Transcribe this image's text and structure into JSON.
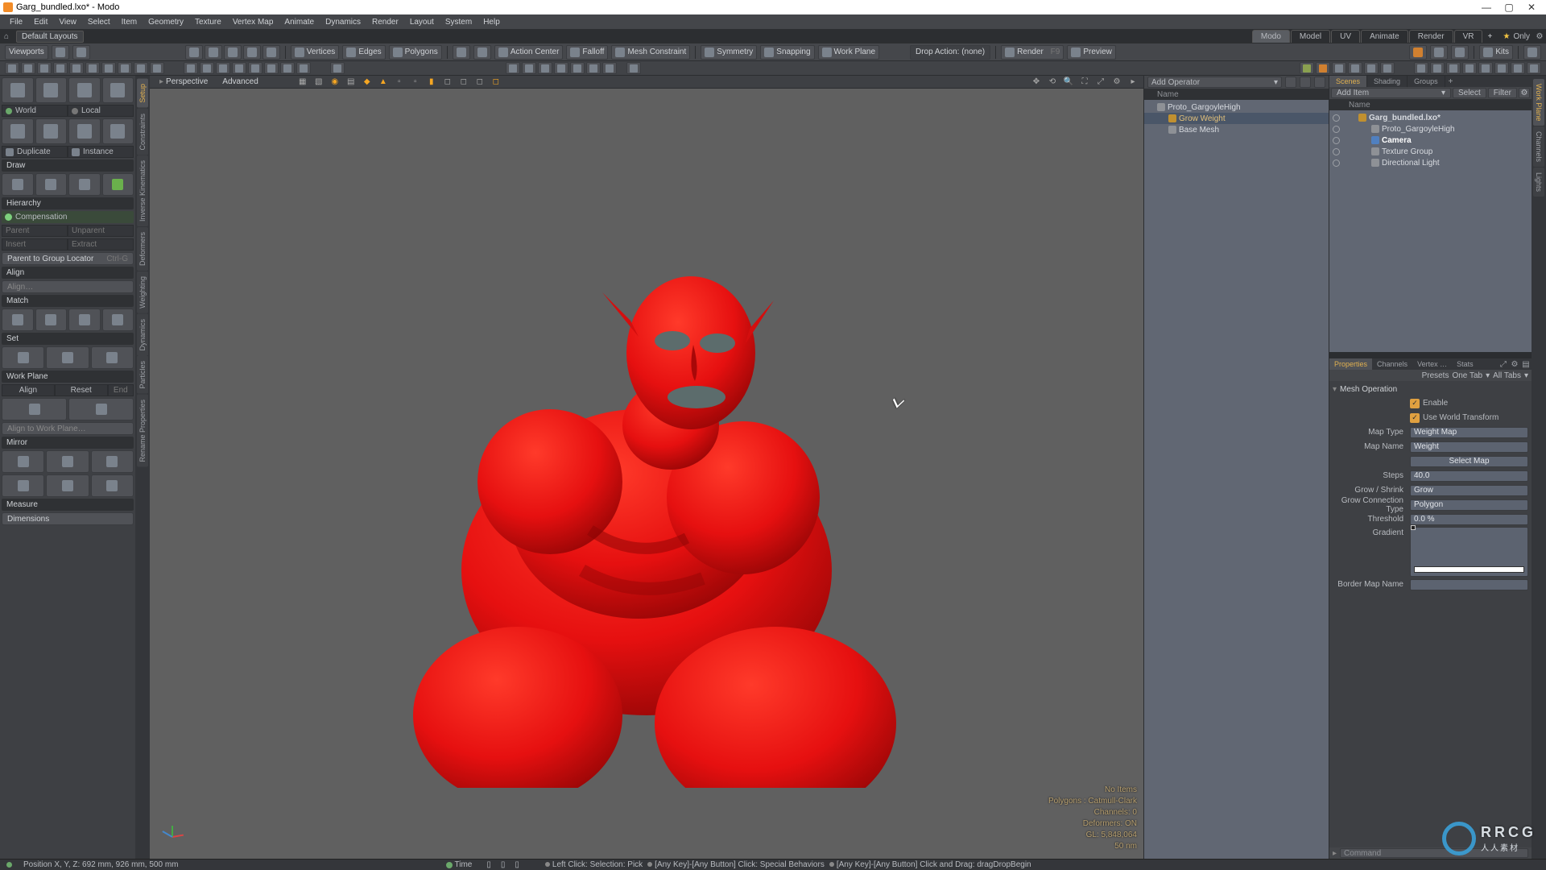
{
  "window": {
    "title": "Garg_bundled.lxo* - Modo"
  },
  "menus": [
    "File",
    "Edit",
    "View",
    "Select",
    "Item",
    "Geometry",
    "Texture",
    "Vertex Map",
    "Animate",
    "Dynamics",
    "Render",
    "Layout",
    "System",
    "Help"
  ],
  "layouts_dropdown": "Default Layouts",
  "layout_tabs": [
    "Modo",
    "Model",
    "UV",
    "Animate",
    "Render",
    "VR"
  ],
  "layout_active": "Modo",
  "only_label": "Only",
  "ribbon": {
    "viewports_label": "Viewports",
    "vertices": "Vertices",
    "edges": "Edges",
    "polygons": "Polygons",
    "action_center": "Action Center",
    "falloff": "Falloff",
    "mesh_constraint": "Mesh Constraint",
    "symmetry": "Symmetry",
    "snapping": "Snapping",
    "work_plane": "Work Plane",
    "drop_action": "Drop Action: (none)",
    "render": "Render",
    "render_key": "F9",
    "preview": "Preview",
    "kits": "Kits"
  },
  "viewport": {
    "tab_perspective": "Perspective",
    "tab_advanced": "Advanced",
    "overlay": {
      "no_items": "No Items",
      "polygons": "Polygons : Catmull-Clark",
      "channels": "Channels: 0",
      "deformers": "Deformers: ON",
      "gl": "GL: 5,848,064",
      "dist": "50 nm"
    }
  },
  "ops": {
    "add_operator": "Add Operator",
    "name_col": "Name",
    "tree": [
      {
        "label": "Proto_GargoyleHigh",
        "level": 0
      },
      {
        "label": "Grow Weight",
        "level": 1,
        "selected": true
      },
      {
        "label": "Base Mesh",
        "level": 1
      }
    ]
  },
  "scene": {
    "tabs": [
      "Scenes",
      "Shading",
      "Groups"
    ],
    "active_tab": "Scenes",
    "add_item": "Add Item",
    "select": "Select",
    "filter": "Filter",
    "name_col": "Name",
    "tree": [
      {
        "label": "Garg_bundled.lxo*",
        "level": 0,
        "bold": true
      },
      {
        "label": "Proto_GargoyleHigh",
        "level": 1
      },
      {
        "label": "Camera",
        "level": 1,
        "bold": true,
        "selected": true
      },
      {
        "label": "Texture Group",
        "level": 1
      },
      {
        "label": "Directional Light",
        "level": 1
      }
    ]
  },
  "properties": {
    "tabs": [
      "Properties",
      "Channels",
      "Vertex …",
      "Stats"
    ],
    "active_tab": "Properties",
    "presets": "Presets",
    "one_tab": "One Tab",
    "all_tabs": "All Tabs",
    "section": "Mesh Operation",
    "enable": "Enable",
    "use_world": "Use World Transform",
    "map_type_lbl": "Map Type",
    "map_type_val": "Weight Map",
    "map_name_lbl": "Map Name",
    "map_name_val": "Weight",
    "select_map": "Select Map",
    "steps_lbl": "Steps",
    "steps_val": "40.0",
    "grow_shrink_lbl": "Grow / Shrink",
    "grow_shrink_val": "Grow",
    "conn_type_lbl": "Grow Connection Type",
    "conn_type_val": "Polygon",
    "threshold_lbl": "Threshold",
    "threshold_val": "0.0 %",
    "gradient_lbl": "Gradient",
    "border_lbl": "Border Map Name"
  },
  "left_tabs": [
    "Setup",
    "Constraints",
    "Inverse Kinematics",
    "Deformers",
    "Weighting",
    "Dynamics",
    "Particles",
    "Rename Properties"
  ],
  "left_active_tab": "Setup",
  "right_tabs": [
    "Work Plane",
    "Channels",
    "Lights"
  ],
  "right_active_tab": "Work Plane",
  "left_panel": {
    "world": "World",
    "local": "Local",
    "duplicate": "Duplicate",
    "instance": "Instance",
    "draw": "Draw",
    "hierarchy": "Hierarchy",
    "compensation": "Compensation",
    "parent": "Parent",
    "unparent": "Unparent",
    "insert": "Insert",
    "extract": "Extract",
    "parent_to_group": "Parent to Group Locator",
    "parent_to_group_key": "Ctrl-G",
    "align": "Align",
    "align_item": "Align…",
    "match": "Match",
    "set": "Set",
    "work_plane": "Work Plane",
    "align_btn": "Align",
    "reset_btn": "Reset",
    "end_btn": "End",
    "align_to_wp": "Align to Work Plane…",
    "mirror": "Mirror",
    "measure": "Measure",
    "dimensions": "Dimensions"
  },
  "status": {
    "position": "Position X, Y, Z:   692 mm, 926 mm, 500 mm",
    "time": "Time",
    "hint1": "Left Click: Selection: Pick",
    "hint2": "[Any Key]-[Any Button] Click: Special Behaviors",
    "hint3": "[Any Key]-[Any Button] Click and Drag: dragDropBegin",
    "command": "Command"
  },
  "watermark": {
    "text": "RRCG",
    "sub": "人人素材"
  }
}
